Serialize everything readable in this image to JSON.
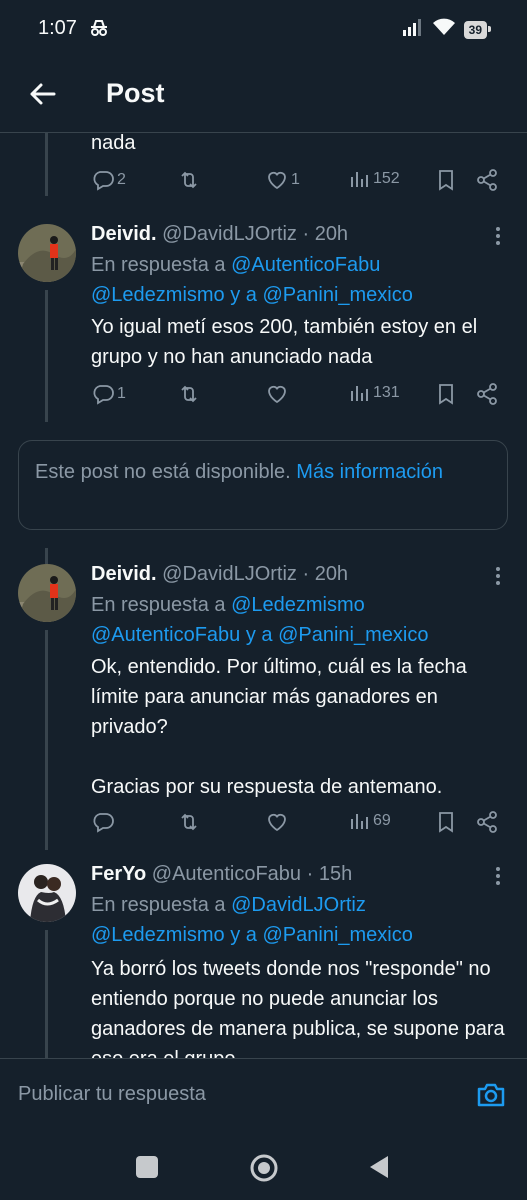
{
  "status": {
    "time": "1:07",
    "battery": "39"
  },
  "header": {
    "title": "Post"
  },
  "tweet0": {
    "text_tail": "nada",
    "replies": "2",
    "retweets": "",
    "likes": "1",
    "views": "152"
  },
  "tweet1": {
    "name": "Deivid.",
    "handle": "@DavidLJOrtiz · 20h",
    "reply_prefix": "En respuesta a ",
    "mention1": "@AutenticoFabu",
    "mention2": "@Ledezmismo",
    "reply_join": " y a ",
    "mention3": "@Panini_mexico",
    "text": "Yo igual metí esos 200, también estoy en el grupo y no han anunciado nada",
    "replies": "1",
    "likes": "",
    "views": "131"
  },
  "unavailable": {
    "text": "Este post no está disponible. ",
    "link": "Más información"
  },
  "tweet2": {
    "name": "Deivid.",
    "handle": "@DavidLJOrtiz · 20h",
    "reply_prefix": "En respuesta a ",
    "mention1": "@Ledezmismo",
    "mention2": "@AutenticoFabu",
    "reply_join": " y a ",
    "mention3": "@Panini_mexico",
    "text": "Ok, entendido. Por último, cuál es la fecha límite para anunciar más ganadores en privado?\n\nGracias por su respuesta de antemano.",
    "replies": "",
    "likes": "",
    "views": "69"
  },
  "tweet3": {
    "name": "FerYo",
    "handle": "@AutenticoFabu · 15h",
    "reply_prefix": "En respuesta a ",
    "mention1": "@DavidLJOrtiz",
    "mention2": "@Ledezmismo",
    "reply_join": " y a ",
    "mention3": "@Panini_mexico",
    "text": "Ya borró los tweets donde nos \"responde\" no entiendo porque no puede anunciar los ganadores de manera publica, se supone para eso era el grupo"
  },
  "reply_bar": {
    "placeholder": "Publicar tu respuesta"
  },
  "colors": {
    "bg": "#15202b",
    "text": "#f7f9f9",
    "muted": "#8b98a5",
    "accent": "#1d9bf0",
    "border": "#38444d"
  }
}
